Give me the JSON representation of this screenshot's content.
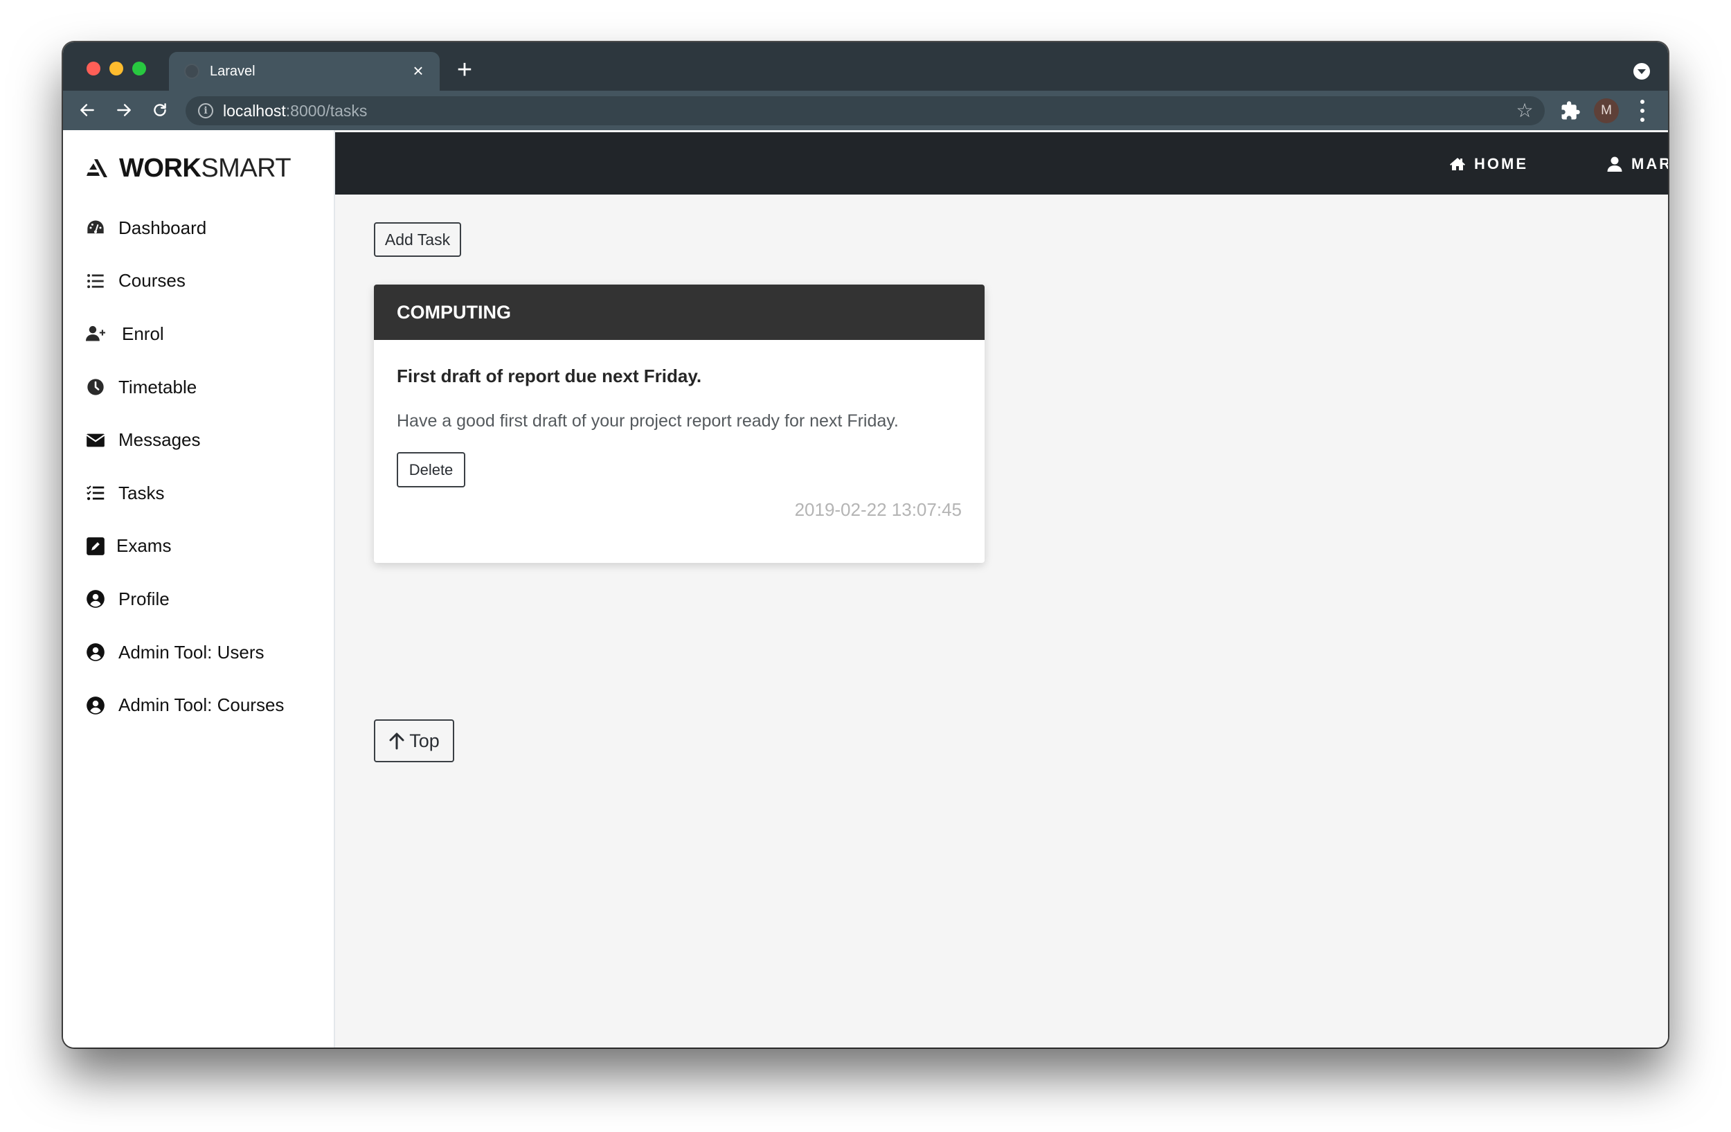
{
  "browser": {
    "tab_title": "Laravel",
    "close_tab_glyph": "×",
    "new_tab_glyph": "+",
    "url_host": "localhost",
    "url_rest": ":8000/tasks",
    "avatar_initial": "M",
    "star_glyph": "☆"
  },
  "brand": {
    "bold": "WORK",
    "light": "SMART"
  },
  "sidebar": {
    "items": [
      {
        "label": "Dashboard",
        "icon": "tachometer-icon"
      },
      {
        "label": "Courses",
        "icon": "list-icon"
      },
      {
        "label": "Enrol",
        "icon": "user-plus-icon"
      },
      {
        "label": "Timetable",
        "icon": "clock-icon"
      },
      {
        "label": "Messages",
        "icon": "envelope-icon"
      },
      {
        "label": "Tasks",
        "icon": "tasks-icon"
      },
      {
        "label": "Exams",
        "icon": "edit-icon"
      },
      {
        "label": "Profile",
        "icon": "user-circle-icon"
      },
      {
        "label": "Admin Tool: Users",
        "icon": "user-circle-icon"
      },
      {
        "label": "Admin Tool: Courses",
        "icon": "user-circle-icon"
      }
    ]
  },
  "navbar": {
    "home_label": "HOME",
    "user_label": "MARK"
  },
  "main": {
    "add_task_label": "Add Task",
    "top_label": "Top",
    "tasks": [
      {
        "course": "COMPUTING",
        "title": "First draft of report due next Friday.",
        "description": "Have a good first draft of your project report ready for next Friday.",
        "delete_label": "Delete",
        "timestamp": "2019-02-22 13:07:45"
      }
    ]
  }
}
